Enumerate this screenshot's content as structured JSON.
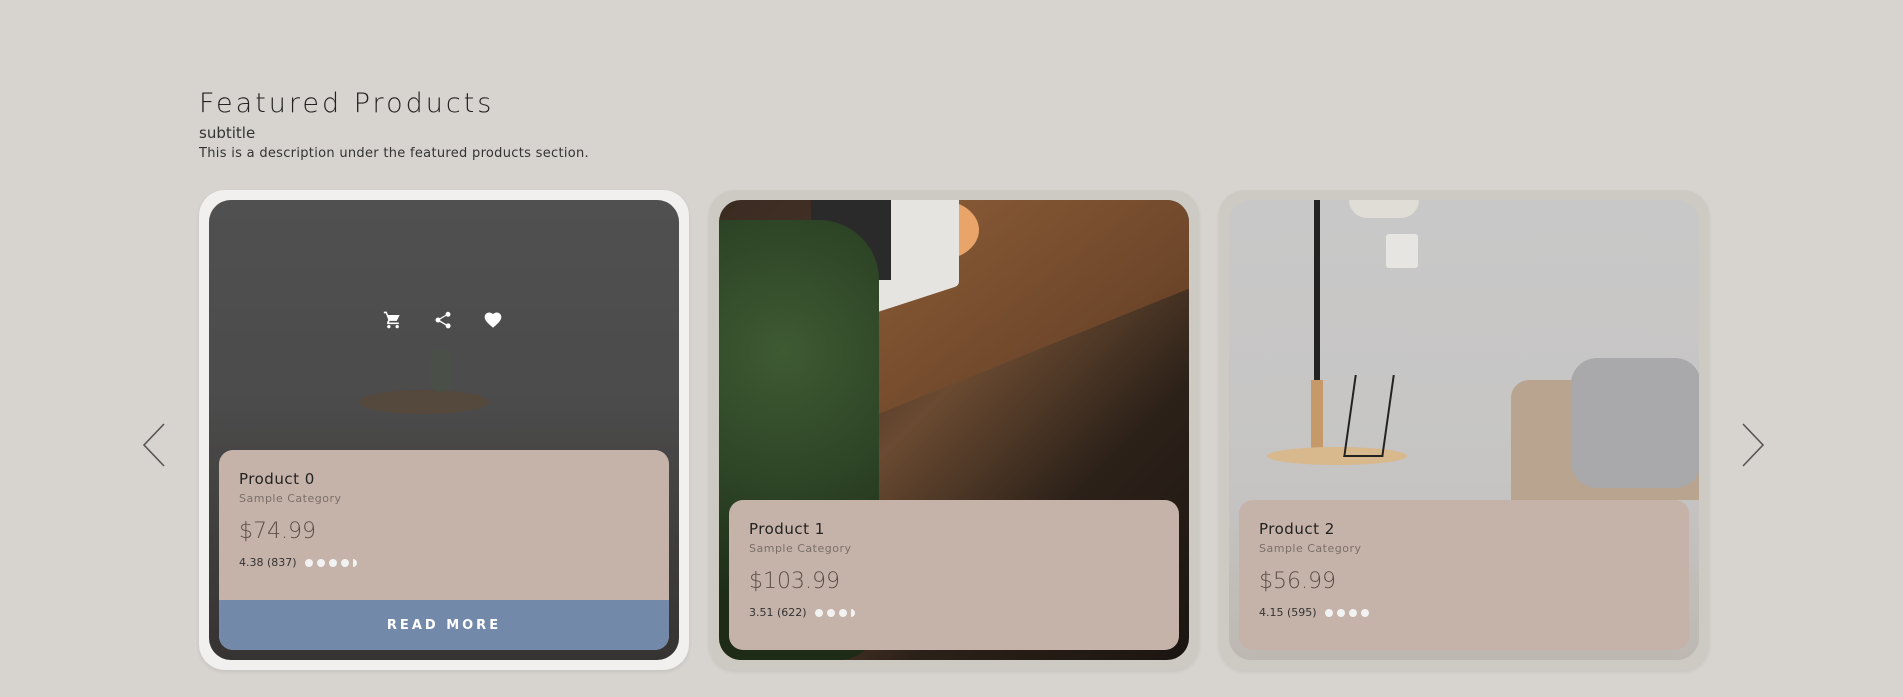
{
  "section": {
    "title": "Featured Products",
    "subtitle": "subtitle",
    "description": "This is a description under the featured products section."
  },
  "nav": {
    "prev_icon": "chevron-left-icon",
    "next_icon": "chevron-right-icon"
  },
  "products": [
    {
      "name": "Product 0",
      "category": "Sample Category",
      "price": "$74.99",
      "rating_text": "4.38 (837)",
      "rating": 4.38,
      "read_more": "READ MORE",
      "actions": [
        "cart-icon",
        "share-icon",
        "heart-icon"
      ]
    },
    {
      "name": "Product 1",
      "category": "Sample Category",
      "price": "$103.99",
      "rating_text": "3.51 (622)",
      "rating": 3.51
    },
    {
      "name": "Product 2",
      "category": "Sample Category",
      "price": "$56.99",
      "rating_text": "4.15 (595)",
      "rating": 4.15
    }
  ],
  "colors": {
    "background": "#d7d4cf",
    "info_panel": "#c5b3aa",
    "read_more": "#7389aa"
  }
}
